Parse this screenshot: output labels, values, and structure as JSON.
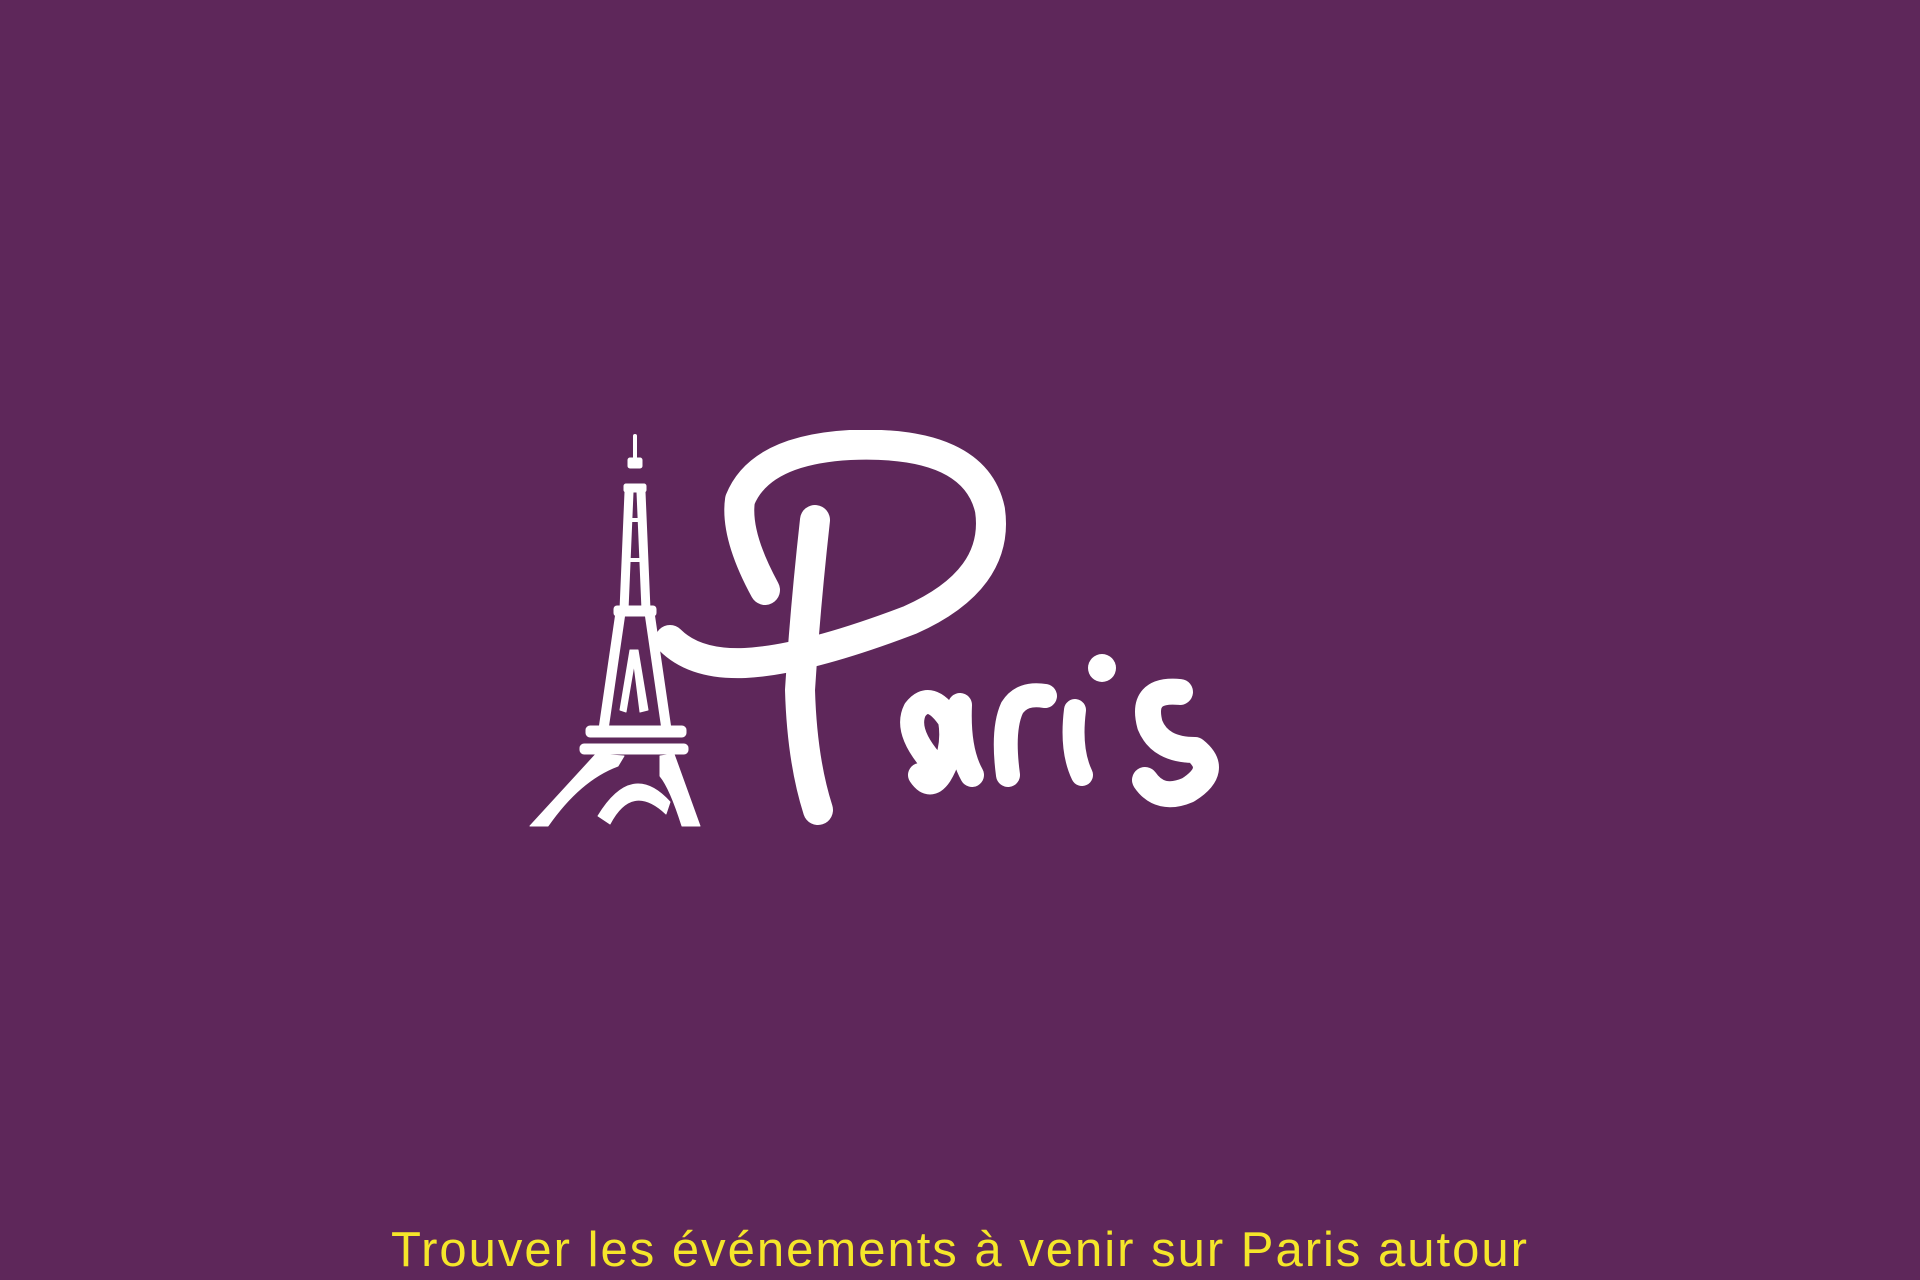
{
  "logo": {
    "wordmark": "Paris",
    "icon": "eiffel-tower-icon"
  },
  "tagline": "Trouver les événements à venir sur Paris autour",
  "colors": {
    "background": "#5e275a",
    "logo": "#ffffff",
    "tagline": "#f5e62a"
  }
}
